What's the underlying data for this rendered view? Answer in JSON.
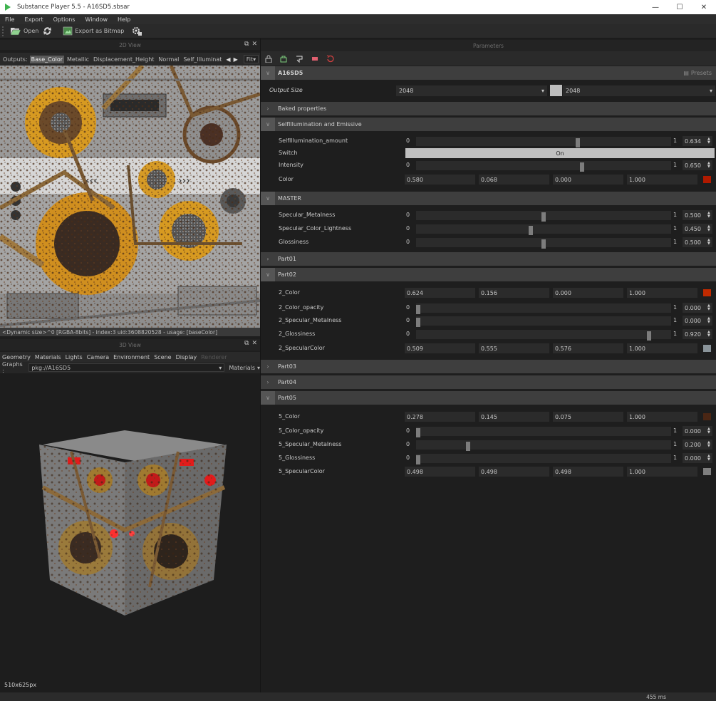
{
  "window": {
    "title": "Substance Player 5.5 - A16SD5.sbsar",
    "minimize": "—",
    "maximize": "☐",
    "close": "✕"
  },
  "menu": [
    "File",
    "Export",
    "Options",
    "Window",
    "Help"
  ],
  "toolbar": {
    "open": "Open",
    "export": "Export as Bitmap"
  },
  "view2d": {
    "title": "2D View",
    "outputs_label": "Outputs:",
    "outputs": [
      "Base_Color",
      "Metallic",
      "Displacement_Height",
      "Normal",
      "Self_Illuminat"
    ],
    "fit": "Fit",
    "status": "<Dynamic size>^0 [RGBA-8bits] - index:3 uid:3608820528 - usage: [baseColor]"
  },
  "view3d": {
    "title": "3D View",
    "tabs": [
      "Geometry",
      "Materials",
      "Lights",
      "Camera",
      "Environment",
      "Scene",
      "Display",
      "Renderer"
    ],
    "graphs_label": "Graphs :",
    "graph": "pkg://A16SD5",
    "materials": "Materials",
    "resolution": "510x625px"
  },
  "params": {
    "title": "Parameters",
    "root": "A16SD5",
    "presets": "Presets",
    "output_size_label": "Output Size",
    "output_size_w": "2048",
    "output_size_h": "2048",
    "sections": {
      "baked": "Baked properties",
      "self_illum": "SelfIllumination and Emissive",
      "master": "MASTER",
      "part01": "Part01",
      "part02": "Part02",
      "part03": "Part03",
      "part04": "Part04",
      "part05": "Part05"
    },
    "rows": {
      "si_amount": {
        "label": "SelfIllumination_amount",
        "min": "0",
        "max": "1",
        "value": "0.634"
      },
      "switch": {
        "label": "Switch",
        "value": "On"
      },
      "intensity": {
        "label": "Intensity",
        "min": "0",
        "max": "1",
        "value": "0.650"
      },
      "color": {
        "label": "Color",
        "r": "0.580",
        "g": "0.068",
        "b": "0.000",
        "a": "1.000",
        "swatch": "#b01a00"
      },
      "spec_metal": {
        "label": "Specular_Metalness",
        "min": "0",
        "max": "1",
        "value": "0.500"
      },
      "spec_light": {
        "label": "Specular_Color_Lightness",
        "min": "0",
        "max": "1",
        "value": "0.450"
      },
      "gloss": {
        "label": "Glossiness",
        "min": "0",
        "max": "1",
        "value": "0.500"
      },
      "p2_color": {
        "label": "2_Color",
        "r": "0.624",
        "g": "0.156",
        "b": "0.000",
        "a": "1.000",
        "swatch": "#c02a00"
      },
      "p2_opacity": {
        "label": "2_Color_opacity",
        "min": "0",
        "max": "1",
        "value": "0.000"
      },
      "p2_metal": {
        "label": "2_Specular_Metalness",
        "min": "0",
        "max": "1",
        "value": "0.000"
      },
      "p2_gloss": {
        "label": "2_Glossiness",
        "min": "0",
        "max": "1",
        "value": "0.920"
      },
      "p2_speccolor": {
        "label": "2_SpecularColor",
        "r": "0.509",
        "g": "0.555",
        "b": "0.576",
        "a": "1.000",
        "swatch": "#8a949a"
      },
      "p5_color": {
        "label": "5_Color",
        "r": "0.278",
        "g": "0.145",
        "b": "0.075",
        "a": "1.000",
        "swatch": "#4a2614"
      },
      "p5_opacity": {
        "label": "5_Color_opacity",
        "min": "0",
        "max": "1",
        "value": "0.000"
      },
      "p5_metal": {
        "label": "5_Specular_Metalness",
        "min": "0",
        "max": "1",
        "value": "0.200"
      },
      "p5_gloss": {
        "label": "5_Glossiness",
        "min": "0",
        "max": "1",
        "value": "0.000"
      },
      "p5_speccolor": {
        "label": "5_SpecularColor",
        "r": "0.498",
        "g": "0.498",
        "b": "0.498",
        "a": "1.000",
        "swatch": "#7f7f7f"
      }
    }
  },
  "status": {
    "time": "455 ms"
  }
}
